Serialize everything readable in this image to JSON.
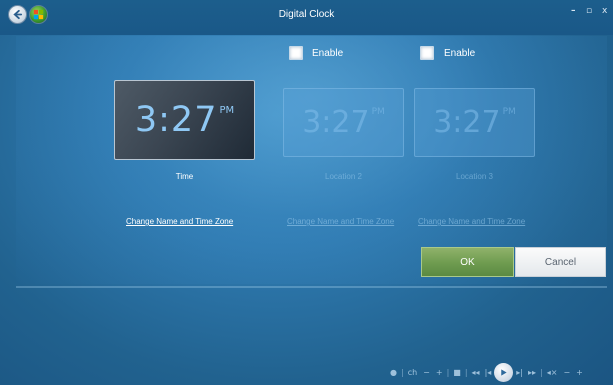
{
  "window": {
    "title": "Digital Clock",
    "controls": {
      "minimize": "–",
      "restore": "▫",
      "close": "x"
    }
  },
  "locations": [
    {
      "caption": "Time",
      "time": "3:27",
      "ampm": "PM",
      "link": "Change Name and Time Zone",
      "enabled": true
    },
    {
      "enable_label": "Enable",
      "enable_checked": false,
      "caption": "Location 2",
      "time": "3:27",
      "ampm": "PM",
      "link": "Change Name and Time Zone",
      "enabled": false
    },
    {
      "enable_label": "Enable",
      "enable_checked": false,
      "caption": "Location 3",
      "time": "3:27",
      "ampm": "PM",
      "link": "Change Name and Time Zone",
      "enabled": false
    }
  ],
  "buttons": {
    "ok": "OK",
    "cancel": "Cancel"
  },
  "transport": {
    "record": "●",
    "channel": "ch",
    "ch_down": "−",
    "ch_up": "+",
    "stop": "■",
    "rewind": "◂◂",
    "prev": "|◂",
    "next": "▸|",
    "fast_forward": "▸▸",
    "mute": "◂×",
    "vol_down": "−",
    "vol_up": "+"
  },
  "colors": {
    "ok_button": "#6e9b4f",
    "background": "#2f7ab0",
    "clock_digits": "#8fc8f4"
  }
}
